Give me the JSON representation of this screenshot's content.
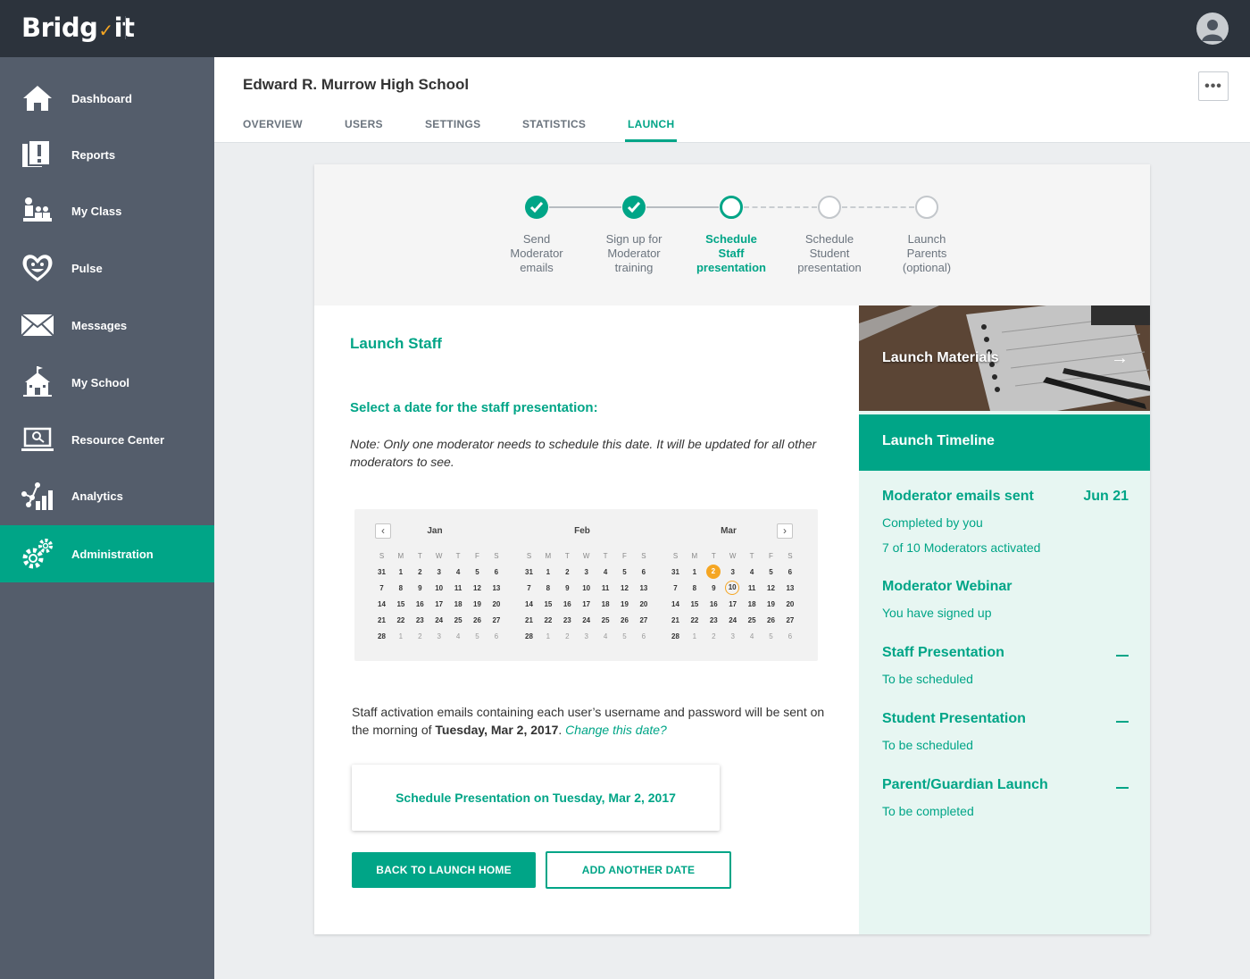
{
  "app": {
    "logo_pre": "Bridg",
    "logo_post": "it"
  },
  "sidebar": {
    "items": [
      {
        "label": "Dashboard",
        "icon": "house-icon"
      },
      {
        "label": "Reports",
        "icon": "report-icon"
      },
      {
        "label": "My Class",
        "icon": "class-icon"
      },
      {
        "label": "Pulse",
        "icon": "heart-face-icon"
      },
      {
        "label": "Messages",
        "icon": "envelope-icon"
      },
      {
        "label": "My School",
        "icon": "school-icon"
      },
      {
        "label": "Resource Center",
        "icon": "laptop-search-icon"
      },
      {
        "label": "Analytics",
        "icon": "analytics-icon"
      },
      {
        "label": "Administration",
        "icon": "gears-icon"
      }
    ]
  },
  "header": {
    "school_name": "Edward R. Murrow High School",
    "more": "•••",
    "tabs": [
      "OVERVIEW",
      "USERS",
      "SETTINGS",
      "STATISTICS",
      "LAUNCH"
    ]
  },
  "stepper": {
    "steps": [
      {
        "lines": [
          "Send",
          "Moderator",
          "emails"
        ],
        "state": "done"
      },
      {
        "lines": [
          "Sign up for",
          "Moderator",
          "training"
        ],
        "state": "done"
      },
      {
        "lines": [
          "Schedule",
          "Staff",
          "presentation"
        ],
        "state": "current"
      },
      {
        "lines": [
          "Schedule",
          "Student",
          "presentation"
        ],
        "state": "todo"
      },
      {
        "lines": [
          "Launch",
          "Parents",
          "(optional)"
        ],
        "state": "todo"
      }
    ]
  },
  "content": {
    "title": "Launch Staff",
    "select_date": "Select a date for the staff presentation:",
    "note": "Note: Only one moderator needs to schedule this date.  It will be updated for all other moderators to see.",
    "activation_text": "Staff activation emails containing each user’s username and password will be sent on the morning of ",
    "activation_date": "Tuesday, Mar 2, 2017",
    "activation_period": ". ",
    "change_link": "Change this date?",
    "schedule_button": "Schedule Presentation on Tuesday, Mar 2, 2017",
    "back_button": "BACK TO LAUNCH HOME",
    "add_button": "ADD ANOTHER DATE"
  },
  "calendar": {
    "prev": "‹",
    "next": "›",
    "dow": [
      "S",
      "M",
      "T",
      "W",
      "T",
      "F",
      "S"
    ],
    "months": [
      {
        "name": "Jan",
        "weeks": [
          [
            "31",
            "1",
            "2",
            "3",
            "4",
            "5",
            "6"
          ],
          [
            "7",
            "8",
            "9",
            "10",
            "11",
            "12",
            "13"
          ],
          [
            "14",
            "15",
            "16",
            "17",
            "18",
            "19",
            "20"
          ],
          [
            "21",
            "22",
            "23",
            "24",
            "25",
            "26",
            "27"
          ],
          [
            "28",
            "1",
            "2",
            "3",
            "4",
            "5",
            "6"
          ]
        ]
      },
      {
        "name": "Feb",
        "weeks": [
          [
            "31",
            "1",
            "2",
            "3",
            "4",
            "5",
            "6"
          ],
          [
            "7",
            "8",
            "9",
            "10",
            "11",
            "12",
            "13"
          ],
          [
            "14",
            "15",
            "16",
            "17",
            "18",
            "19",
            "20"
          ],
          [
            "21",
            "22",
            "23",
            "24",
            "25",
            "26",
            "27"
          ],
          [
            "28",
            "1",
            "2",
            "3",
            "4",
            "5",
            "6"
          ]
        ]
      },
      {
        "name": "Mar",
        "weeks": [
          [
            "31",
            "1",
            "2",
            "3",
            "4",
            "5",
            "6"
          ],
          [
            "7",
            "8",
            "9",
            "10",
            "11",
            "12",
            "13"
          ],
          [
            "14",
            "15",
            "16",
            "17",
            "18",
            "19",
            "20"
          ],
          [
            "21",
            "22",
            "23",
            "24",
            "25",
            "26",
            "27"
          ],
          [
            "28",
            "1",
            "2",
            "3",
            "4",
            "5",
            "6"
          ]
        ]
      }
    ],
    "selected_month": 2,
    "selected_day": "2",
    "highlight_month": 2,
    "highlight_day": "10"
  },
  "right": {
    "materials": "Launch Materials",
    "arrow": "→",
    "timeline_title": "Launch Timeline",
    "events": [
      {
        "title": "Moderator emails sent",
        "date": "Jun 21",
        "lines": [
          "Completed by you",
          "7 of 10 Moderators activated"
        ]
      },
      {
        "title": "Moderator Webinar",
        "date": "",
        "lines": [
          "You have signed up"
        ]
      },
      {
        "title": "Staff Presentation",
        "date": "dash",
        "lines": [
          "To be scheduled"
        ]
      },
      {
        "title": "Student Presentation",
        "date": "dash",
        "lines": [
          "To be scheduled"
        ]
      },
      {
        "title": "Parent/Guardian Launch",
        "date": "dash",
        "lines": [
          "To be completed"
        ]
      }
    ]
  },
  "colors": {
    "accent": "#00a587",
    "sidebar": "#545d6b",
    "topbar": "#2c333c",
    "highlight": "#f5a623"
  }
}
